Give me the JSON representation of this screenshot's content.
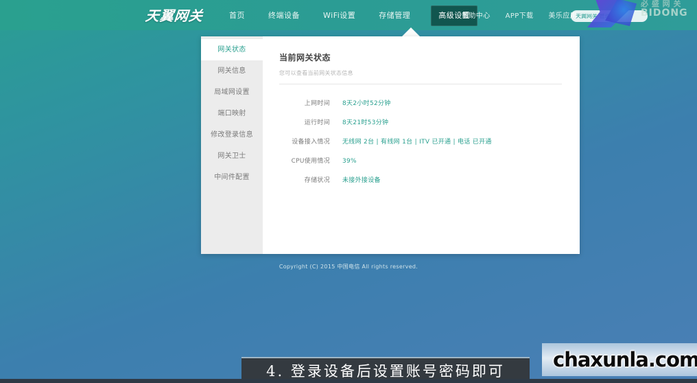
{
  "topbar": {
    "logo_text": "天翼网关",
    "nav_main": [
      {
        "label": "首页",
        "active": false
      },
      {
        "label": "终端设备",
        "active": false
      },
      {
        "label": "WiFi设置",
        "active": false
      },
      {
        "label": "存储管理",
        "active": false
      },
      {
        "label": "高级设置",
        "active": true
      }
    ],
    "nav_secondary": [
      {
        "label": "帮助中心"
      },
      {
        "label": "APP下载"
      },
      {
        "label": "美乐应用"
      }
    ],
    "pill_text": "天翼网关 管理"
  },
  "sidebar": {
    "items": [
      {
        "label": "网关状态",
        "active": true
      },
      {
        "label": "网关信息",
        "active": false
      },
      {
        "label": "局域网设置",
        "active": false
      },
      {
        "label": "端口映射",
        "active": false
      },
      {
        "label": "修改登录信息",
        "active": false
      },
      {
        "label": "网关卫士",
        "active": false
      },
      {
        "label": "中间件配置",
        "active": false
      }
    ]
  },
  "content": {
    "title": "当前网关状态",
    "subtitle": "您可以查看当前网关状态信息",
    "rows": [
      {
        "label": "上网时间",
        "value": "8天2小时52分钟"
      },
      {
        "label": "运行时间",
        "value": "8天21时53分钟"
      },
      {
        "label": "设备接入情况",
        "value": "无线网 2台 | 有线网 1台 | ITV 已开通 | 电话 已开通"
      },
      {
        "label": "CPU使用情况",
        "value": "39%"
      },
      {
        "label": "存储状况",
        "value": "未接外接设备"
      }
    ]
  },
  "footer": {
    "copyright": "Copyright (C) 2015 中国电信 All rights reserved."
  },
  "overlays": {
    "brand_line1": "必 盛 网 关",
    "brand_line2": "BIDONG",
    "caption": "4. 登录设备后设置账号密码即可",
    "watermark": "chaxunla.com"
  },
  "colors": {
    "brand_teal": "#2aa08f",
    "active_tab_bg": "#11564f",
    "value_text": "#2aa08f",
    "sidebar_bg": "#ececec"
  }
}
